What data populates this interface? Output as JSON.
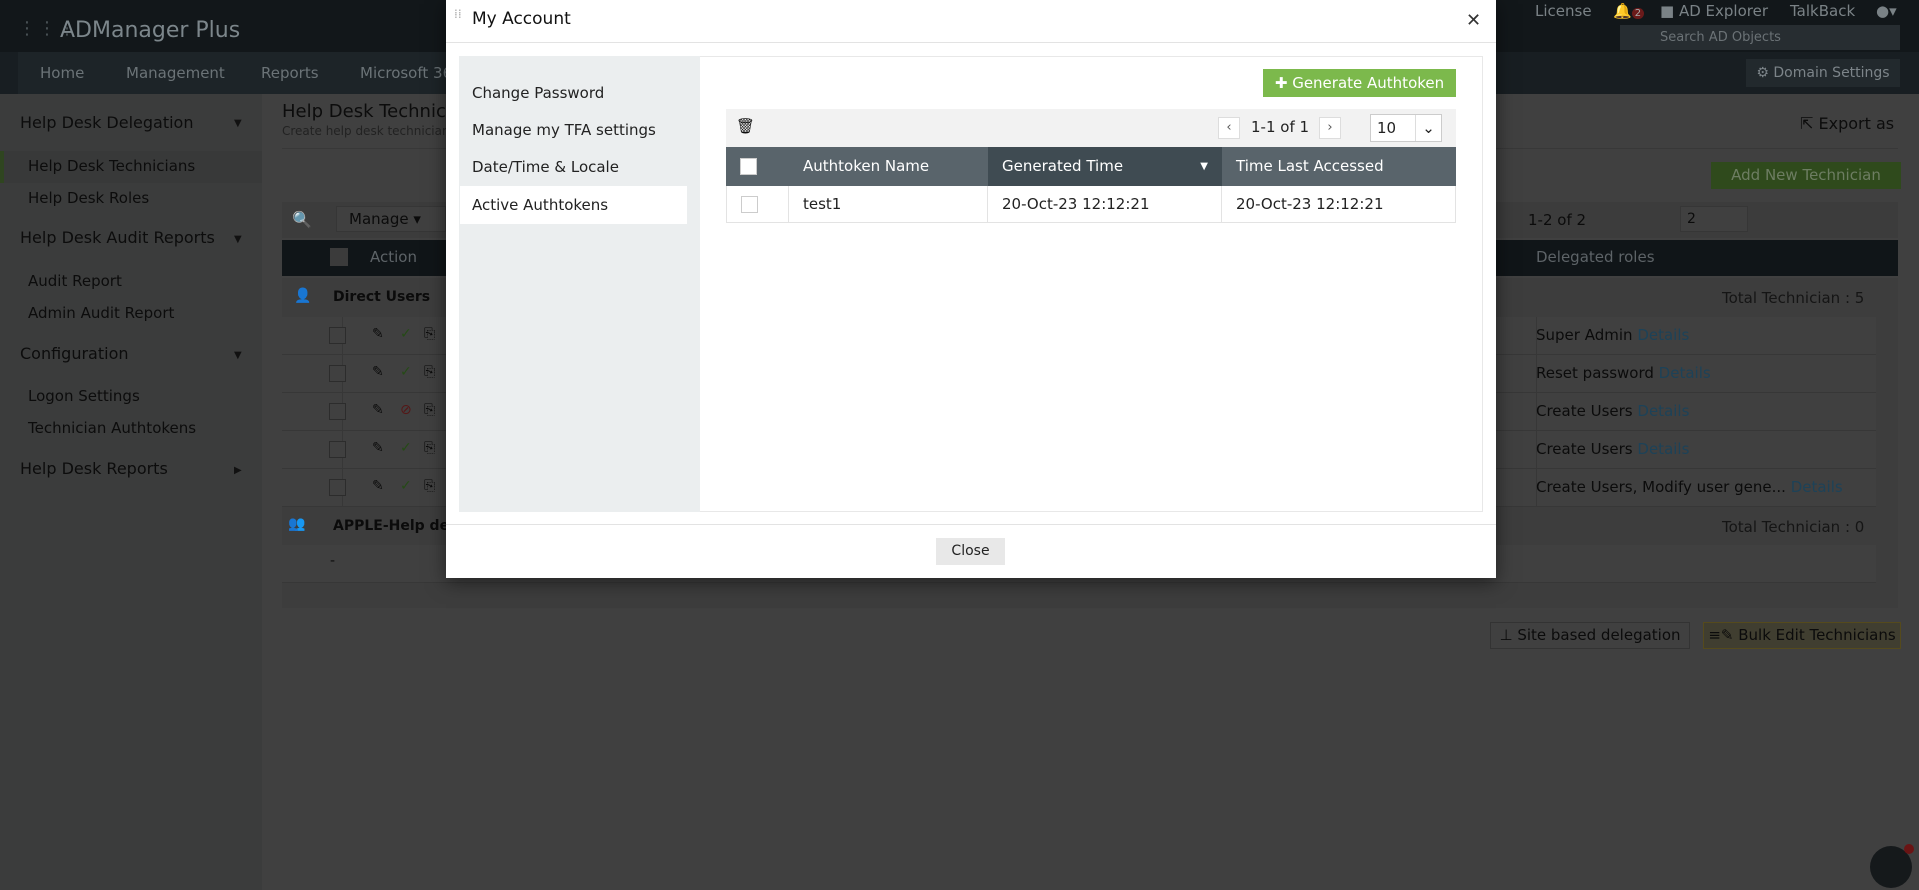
{
  "app": {
    "title": "ADManager Plus",
    "nav": [
      "Home",
      "Management",
      "Reports",
      "Microsoft 365"
    ],
    "top_links": {
      "license": "License",
      "notifications": "2",
      "ad_explorer": "AD Explorer",
      "talkback": "TalkBack"
    },
    "search_placeholder": "Search AD Objects",
    "domain_settings": "Domain Settings"
  },
  "sidebar": {
    "sections": [
      {
        "label": "Help Desk Delegation",
        "items": [
          "Help Desk Technicians",
          "Help Desk Roles"
        ]
      },
      {
        "label": "Help Desk Audit Reports",
        "items": [
          "Audit Report",
          "Admin Audit Report"
        ]
      },
      {
        "label": "Configuration",
        "items": [
          "Logon Settings",
          "Technician Authtokens"
        ]
      },
      {
        "label": "Help Desk Reports",
        "items": []
      }
    ],
    "active": "Help Desk Technicians"
  },
  "main": {
    "title": "Help Desk Technicians",
    "subtitle": "Create help desk technicians",
    "export": "Export as",
    "add_button": "Add New Technician",
    "manage": "Manage",
    "pagination": "1-2 of 2",
    "per_page": "2",
    "col_action": "Action",
    "col_roles": "Delegated roles",
    "group1": {
      "name": "Direct Users",
      "total": "Total Technician : 5"
    },
    "roles": [
      {
        "text": "Super Admin",
        "status": "enabled"
      },
      {
        "text": "Reset password",
        "status": "enabled"
      },
      {
        "text": "Create Users",
        "status": "disabled"
      },
      {
        "text": "Create Users",
        "status": "enabled"
      },
      {
        "text": "Create Users, Modify user gene...",
        "status": "enabled"
      }
    ],
    "details": "Details",
    "group2": {
      "name": "APPLE-Help desk",
      "total": "Total Technician : 0",
      "empty": "-"
    },
    "site_button": "Site based delegation",
    "bulk_button": "Bulk Edit Technicians"
  },
  "modal": {
    "title": "My Account",
    "menu": [
      "Change Password",
      "Manage my TFA settings",
      "Date/Time & Locale",
      "Active Authtokens"
    ],
    "active_menu": "Active Authtokens",
    "generate_button": "Generate Authtoken",
    "pagination": "1-1 of 1",
    "per_page": "10",
    "columns": [
      "Authtoken Name",
      "Generated Time",
      "Time Last Accessed"
    ],
    "rows": [
      {
        "name": "test1",
        "generated": "20-Oct-23 12:12:21",
        "last_accessed": "20-Oct-23 12:12:21"
      }
    ],
    "close_button": "Close"
  },
  "colors": {
    "accent_green": "#7cb94c",
    "header_dark": "#59646b",
    "sorted_header": "#3f4b52"
  }
}
